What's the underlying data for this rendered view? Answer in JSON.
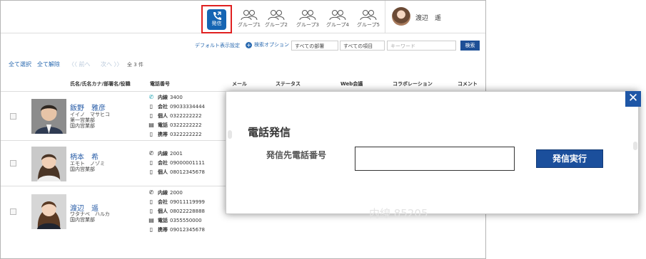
{
  "topbar": {
    "call_label": "発信",
    "groups": [
      "グループ1",
      "グループ2",
      "グループ3",
      "グループ4",
      "グループ5"
    ],
    "user_name": "渡辺　遥"
  },
  "search": {
    "default_view": "デフォルト表示設定",
    "options": "検索オプション",
    "dept_select": "すべての部署",
    "item_select": "すべての項目",
    "keyword_placeholder": "キーワード",
    "search_button": "検索"
  },
  "list": {
    "select_all": "全て選択",
    "deselect_all": "全て解除",
    "prev": "〈〈 前へ",
    "next": "次へ 〉〉",
    "count": "全 3 件"
  },
  "columns": {
    "name": "氏名/氏名カナ/部署名/役職",
    "phone": "電話番号",
    "mail": "メール",
    "status": "ステータス",
    "web": "Web会議",
    "collab": "コラボレーション",
    "comment": "コメント"
  },
  "contacts": [
    {
      "name": "飯野　雅彦",
      "kana": "イイノ　マサヒコ",
      "dept1": "第一営業部",
      "dept2": "国内営業部",
      "phones": [
        {
          "icon": "phone-icon",
          "label": "内線",
          "number": "3400"
        },
        {
          "icon": "mobile-icon",
          "label": "会社",
          "number": "09033334444"
        },
        {
          "icon": "mobile-icon",
          "label": "個人",
          "number": "0322222222"
        },
        {
          "icon": "fax-icon",
          "label": "電話",
          "number": "0322222222"
        },
        {
          "icon": "mobile-icon",
          "label": "携帯",
          "number": "0322222222"
        }
      ]
    },
    {
      "name": "柄本　希",
      "kana": "エモト　ノゾミ",
      "dept1": "国内営業部",
      "dept2": "",
      "phones": [
        {
          "icon": "phone-icon",
          "label": "内線",
          "number": "2001"
        },
        {
          "icon": "mobile-icon",
          "label": "会社",
          "number": "09000001111"
        },
        {
          "icon": "mobile-icon",
          "label": "個人",
          "number": "08012345678"
        }
      ]
    },
    {
      "name": "渡辺　遥",
      "kana": "ワタナベ　ハルカ",
      "dept1": "国内営業部",
      "dept2": "",
      "phones": [
        {
          "icon": "phone-icon",
          "label": "内線",
          "number": "2000"
        },
        {
          "icon": "mobile-icon",
          "label": "会社",
          "number": "09011119999"
        },
        {
          "icon": "mobile-icon",
          "label": "個人",
          "number": "08022228888"
        },
        {
          "icon": "fax-icon",
          "label": "電話",
          "number": "0355550000"
        },
        {
          "icon": "mobile-icon",
          "label": "携帯",
          "number": "09012345678"
        }
      ]
    }
  ],
  "dialog": {
    "title": "電話発信",
    "field_label": "発信先電話番号",
    "number_value": "",
    "execute": "発信実行",
    "close": "✕",
    "ghost_text": "内線 85205"
  },
  "colors": {
    "accent": "#1b4f9c",
    "highlight_border": "#e02020",
    "link": "#2a6ab0"
  }
}
